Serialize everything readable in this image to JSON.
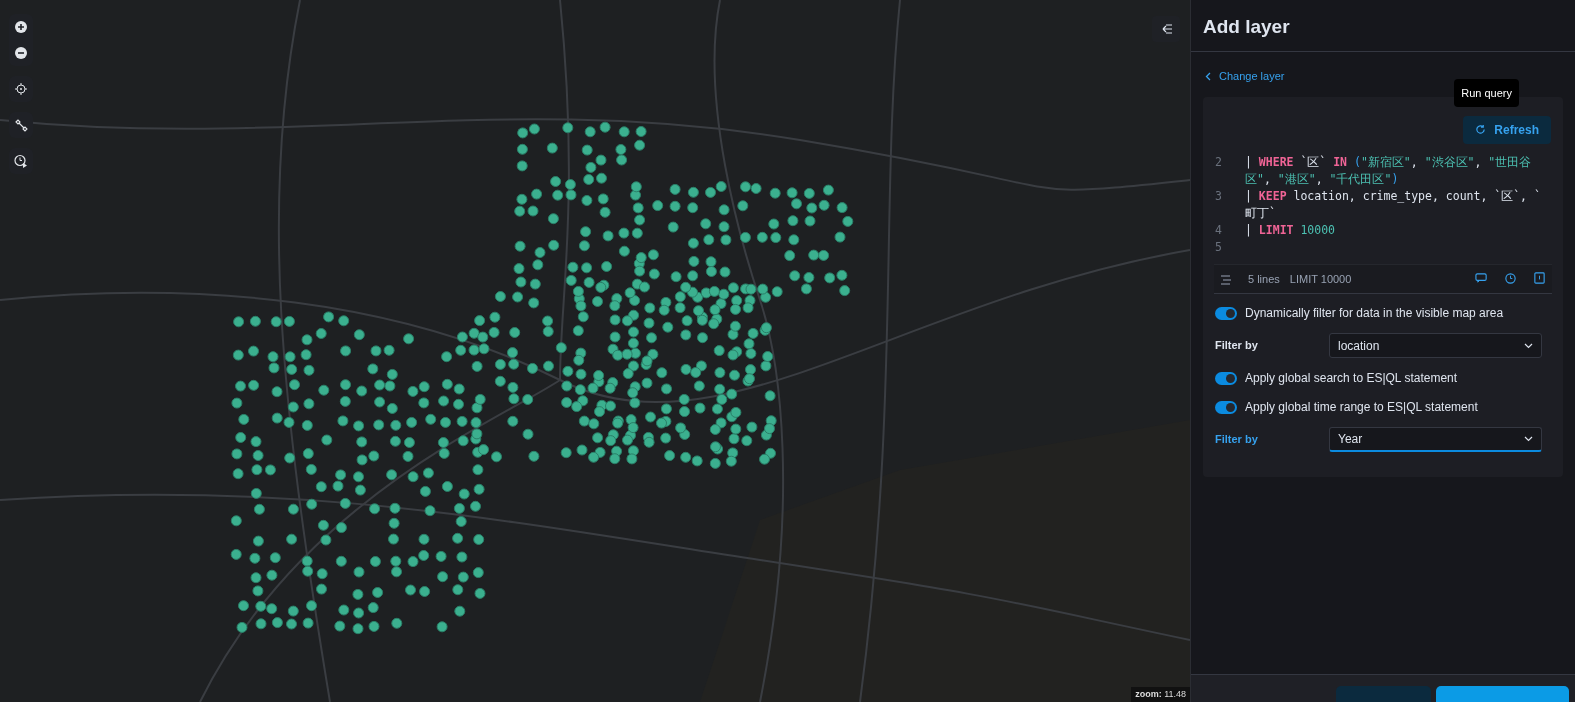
{
  "map": {
    "zoom_label": "zoom:",
    "zoom_value": "11.48"
  },
  "panel": {
    "title": "Add layer",
    "back_link": "Change layer",
    "editor": {
      "tooltip": "Run query",
      "refresh_button": "Refresh",
      "lines": [
        {
          "number": "2",
          "tokens": [
            {
              "kind": "plain",
              "text": "| "
            },
            {
              "kind": "keyword",
              "text": "WHERE"
            },
            {
              "kind": "plain",
              "text": " `区` "
            },
            {
              "kind": "keyword",
              "text": "IN"
            },
            {
              "kind": "paren",
              "text": " ("
            },
            {
              "kind": "string",
              "text": "\"新宿区\""
            },
            {
              "kind": "plain",
              "text": ", "
            },
            {
              "kind": "string",
              "text": "\"渋谷区\""
            },
            {
              "kind": "plain",
              "text": ", "
            },
            {
              "kind": "string",
              "text": "\"世田谷区\""
            },
            {
              "kind": "plain",
              "text": ", "
            },
            {
              "kind": "string",
              "text": "\"港区\""
            },
            {
              "kind": "plain",
              "text": ", "
            },
            {
              "kind": "string",
              "text": "\"千代田区\""
            },
            {
              "kind": "paren",
              "text": ")"
            }
          ]
        },
        {
          "number": "3",
          "tokens": [
            {
              "kind": "plain",
              "text": "| "
            },
            {
              "kind": "keyword",
              "text": "KEEP"
            },
            {
              "kind": "plain",
              "text": " location, crime_type, count, `区`, `町丁`"
            }
          ]
        },
        {
          "number": "4",
          "tokens": [
            {
              "kind": "plain",
              "text": "| "
            },
            {
              "kind": "keyword",
              "text": "LIMIT"
            },
            {
              "kind": "number",
              "text": " 10000"
            }
          ]
        },
        {
          "number": "5"
        }
      ],
      "footer": {
        "line_count": "5 lines",
        "limit": "LIMIT 10000"
      }
    },
    "settings": [
      {
        "kind": "toggle",
        "label": "Dynamically filter for data in the visible map area",
        "on": true
      },
      {
        "kind": "select",
        "label": "Filter by",
        "value": "location",
        "focused": false
      },
      {
        "kind": "toggle",
        "label": "Apply global search to ES|QL statement",
        "on": true
      },
      {
        "kind": "toggle",
        "label": "Apply global time range to ES|QL statement",
        "on": true
      },
      {
        "kind": "select",
        "label": "Filter by",
        "value": "Year",
        "focused": true
      }
    ]
  }
}
